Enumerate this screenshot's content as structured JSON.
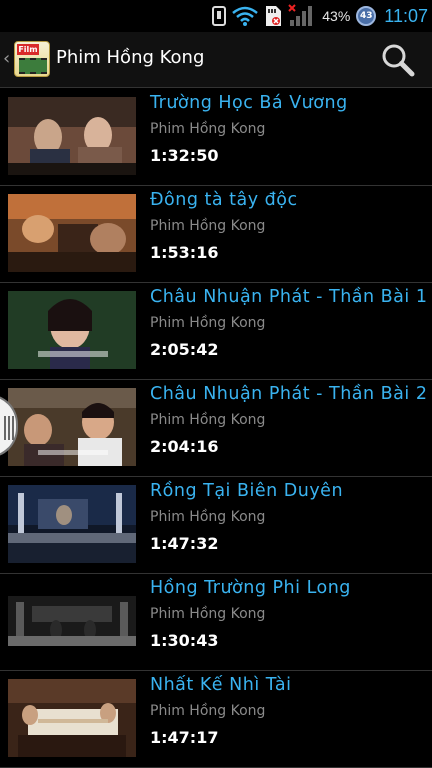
{
  "status_bar": {
    "battery_percent": "43%",
    "battery_level": "43",
    "time": "11:07",
    "icons": [
      "phone-icon",
      "wifi-icon",
      "sd-card-icon",
      "signal-icon",
      "battery-icon"
    ]
  },
  "action_bar": {
    "title": "Phim Hồng Kong",
    "app_icon_text": "Film",
    "search_icon": "search-icon"
  },
  "videos": [
    {
      "title": "Trường Học Bá Vương",
      "channel": "Phim Hồng Kong",
      "duration": "1:32:50"
    },
    {
      "title": "Đông tà tây độc",
      "channel": "Phim Hồng Kong",
      "duration": "1:53:16"
    },
    {
      "title": "Châu Nhuận Phát - Thần Bài 1",
      "channel": "Phim Hồng Kong",
      "duration": "2:05:42"
    },
    {
      "title": "Châu Nhuận Phát - Thần Bài 2",
      "channel": "Phim Hồng Kong",
      "duration": "2:04:16"
    },
    {
      "title": "Rồng Tại Biên Duyên",
      "channel": "Phim Hồng Kong",
      "duration": "1:47:32"
    },
    {
      "title": "Hồng Trường Phi Long",
      "channel": "Phim Hồng Kong",
      "duration": "1:30:43"
    },
    {
      "title": "Nhất Kế Nhì Tài",
      "channel": "Phim Hồng Kong",
      "duration": "1:47:17"
    }
  ],
  "colors": {
    "title_accent": "#3ab3f0",
    "channel_text": "#8a8a8a",
    "background": "#000000"
  }
}
